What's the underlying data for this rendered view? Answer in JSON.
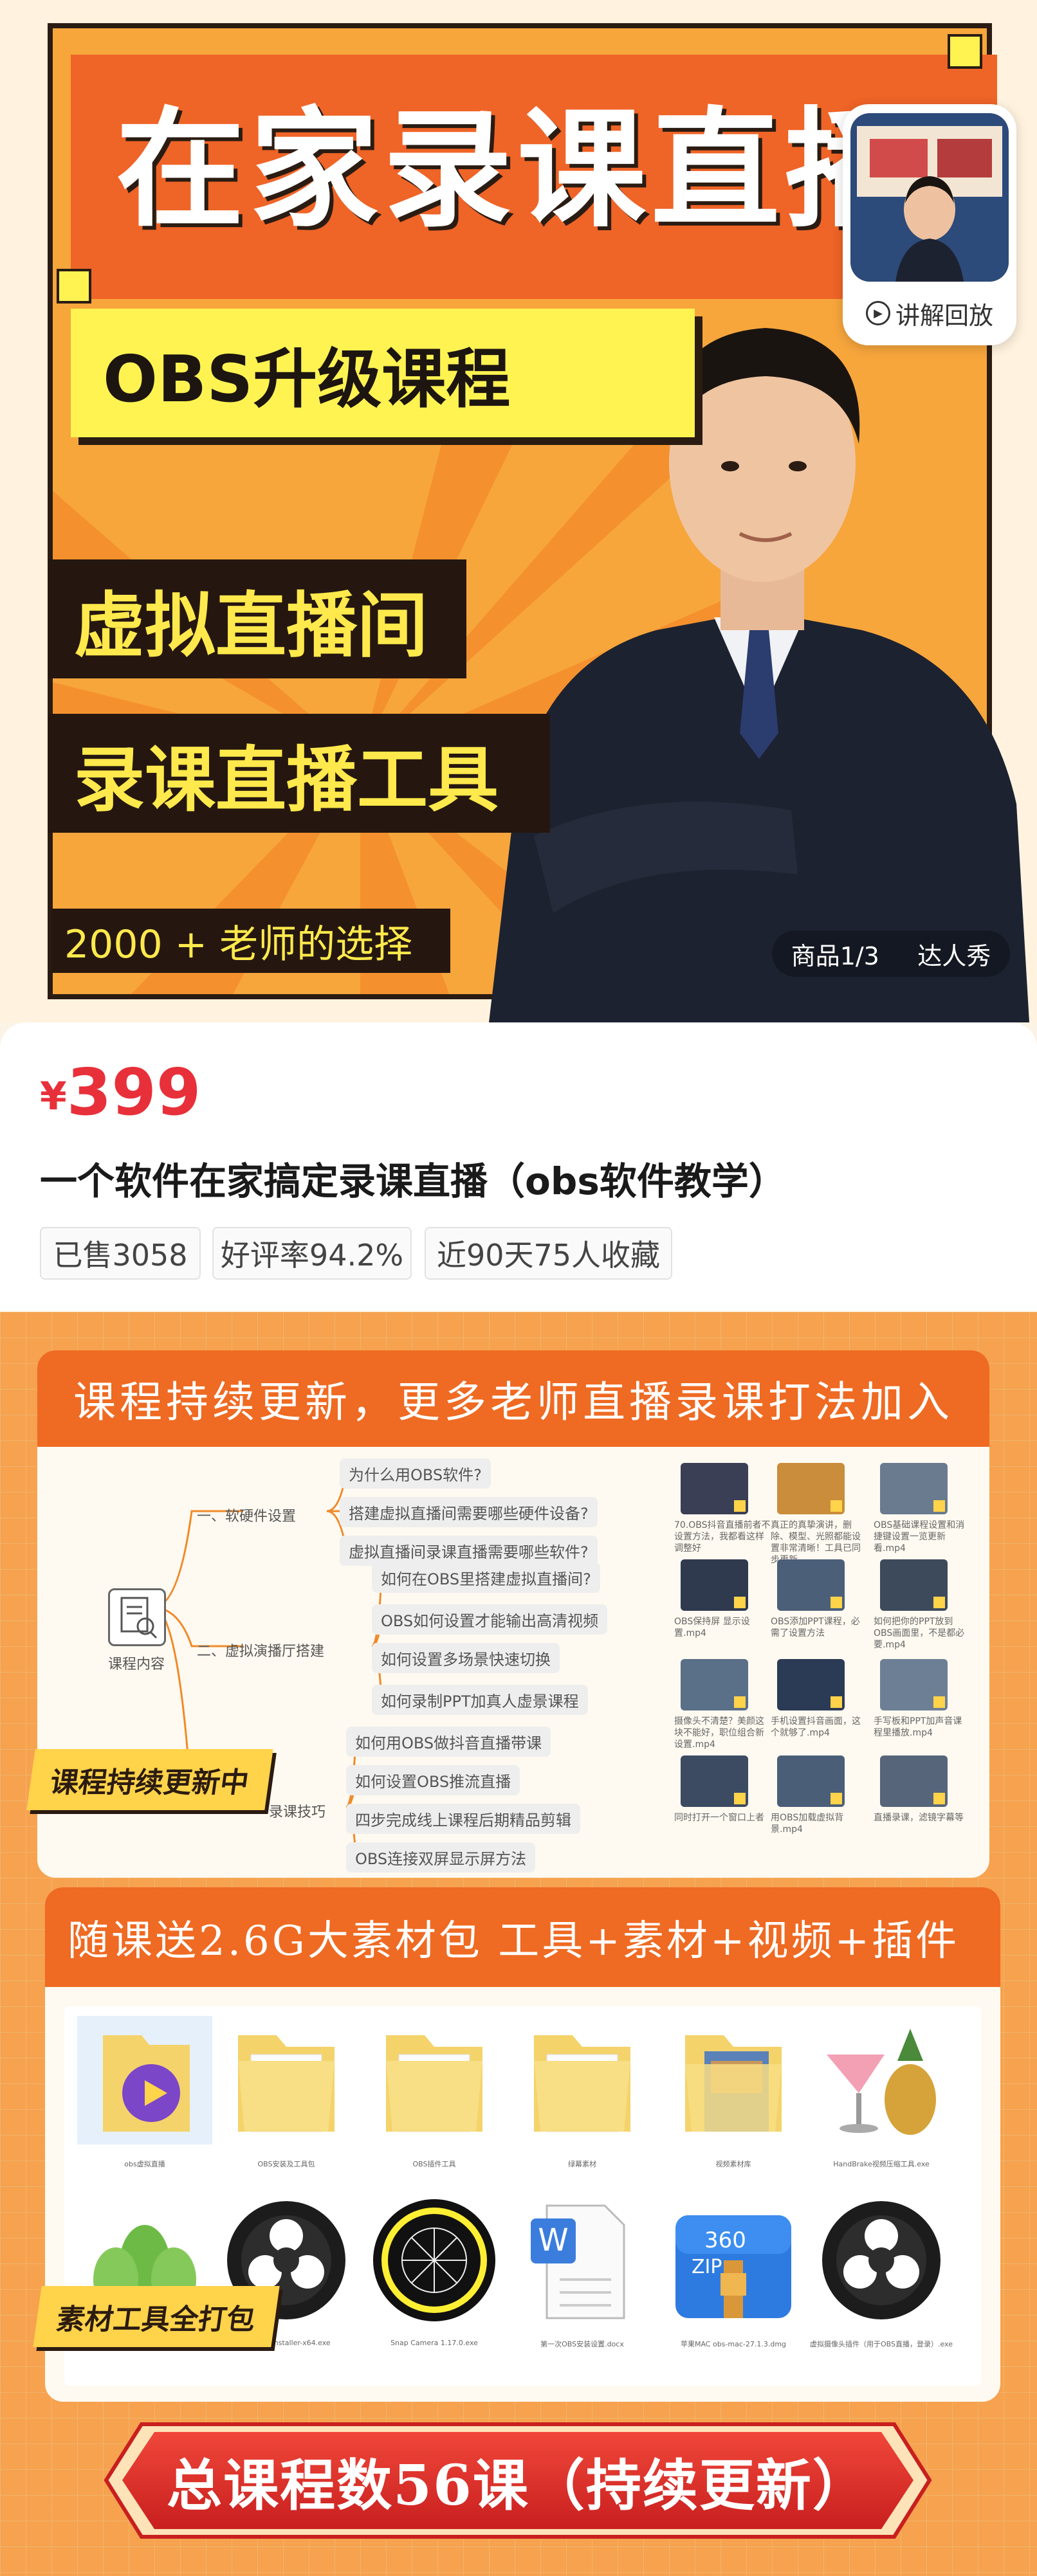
{
  "hero": {
    "title": "在家录课直播",
    "subtitle": "OBS升级课程",
    "line1": "虚拟直播间",
    "line2": "录课直播工具",
    "choice": "2000 + 老师的选择",
    "replay_label": "讲解回放",
    "page_indicator": "商品1/3",
    "talent_show": "达人秀"
  },
  "product": {
    "currency": "¥",
    "price": "399",
    "title": "一个软件在家搞定录课直播（obs软件教学）",
    "tags": [
      "已售3058",
      "好评率94.2%",
      "近90天75人收藏"
    ]
  },
  "detail": {
    "panel1_title": "课程持续更新，更多老师直播录课打法加入",
    "course_root": "课程内容",
    "sections": [
      {
        "name": "一、软硬件设置",
        "items": [
          "为什么用OBS软件?",
          "搭建虚拟直播间需要哪些硬件设备?",
          "虚拟直播间录课直播需要哪些软件?"
        ]
      },
      {
        "name": "二、虚拟演播厅搭建",
        "items": [
          "如何在OBS里搭建虚拟直播间?",
          "OBS如何设置才能输出高清视频",
          "如何设置多场景快速切换",
          "如何录制PPT加真人虚景课程"
        ]
      },
      {
        "name": "录课技巧",
        "items": [
          "如何用OBS做抖音直播带课",
          "如何设置OBS推流直播",
          "四步完成线上课程后期精品剪辑",
          "OBS连接双屏显示屏方法"
        ]
      }
    ],
    "video_captions": [
      "70.OBS抖音直播前者不设置方法，我都看这样调整好",
      "真正的真挚演讲，删除、模型、光照都能设置非常清晰！工具已同步更新",
      "OBS基础课程设置和消捷键设置一览更新看.mp4",
      "OBS保持屏 显示设置.mp4",
      "OBS添加PPT课程，必需了设置方法",
      "如何把你的PPT放到OBS画面里，不是都必要.mp4",
      "摄像头不清楚？美颜这块不能好，职位组合新设置.mp4",
      "手机设置抖音画面，这个就够了.mp4",
      "手写板和PPT加声音课程里播放.mp4",
      "同时打开一个窗口上者",
      "用OBS加载虚拟背景.mp4",
      "直播录课，滤镜字幕等"
    ],
    "sticker1": "课程持续更新中",
    "panel2_title": "随课送2.6G大素材包  工具+素材+视频+插件",
    "assets": [
      "obs虚拟直播",
      "OBS安装及工具包",
      "OBS插件工具",
      "绿幕素材",
      "视频素材库",
      "HandBrake视频压缩工具.exe",
      "小树素材.png",
      "obs-Full-Installer-x64.exe",
      "Snap Camera 1.17.0.exe",
      "第一次OBS安装设置.docx",
      "苹果MAC obs-mac-27.1.3.dmg",
      "虚拟摄像头插件（用于OBS直播，登录）.exe"
    ],
    "sticker2": "素材工具全打包",
    "banner": "总课程数56课（持续更新）"
  },
  "colors": {
    "accent_red": "#e8303a",
    "orange_header": "#ef6a22",
    "yellow": "#fff352",
    "dark": "#25170f"
  }
}
